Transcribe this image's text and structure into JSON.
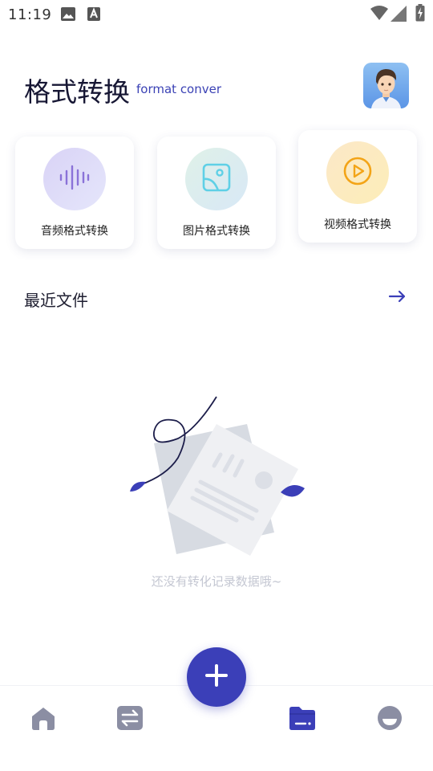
{
  "status_bar": {
    "time": "11:19",
    "icons": [
      "image-icon",
      "a-box-icon",
      "wifi-icon",
      "cell-signal-icon",
      "battery-charging-icon"
    ]
  },
  "header": {
    "title": "格式转换",
    "subtitle": "format conver",
    "avatar": "avatar"
  },
  "features": [
    {
      "label": "音频格式转换",
      "icon": "audio-wave-icon",
      "color": "#8a72d8"
    },
    {
      "label": "图片格式转换",
      "icon": "image-frame-icon",
      "color": "#5fd0e6"
    },
    {
      "label": "视频格式转换",
      "icon": "play-circle-icon",
      "color": "#f3a417"
    }
  ],
  "recent": {
    "title": "最近文件",
    "more_icon": "arrow-right-icon",
    "empty_text": "还没有转化记录数据哦~"
  },
  "bottom_nav": {
    "items": [
      {
        "icon": "home-icon",
        "active": false
      },
      {
        "icon": "convert-icon",
        "active": false
      },
      {
        "icon": "folder-icon",
        "active": true
      },
      {
        "icon": "profile-icon",
        "active": false
      }
    ],
    "fab_icon": "plus-icon"
  },
  "colors": {
    "accent": "#3b3fb8",
    "inactive_nav": "#8b8ea3",
    "empty_text": "#c4c7d2"
  }
}
